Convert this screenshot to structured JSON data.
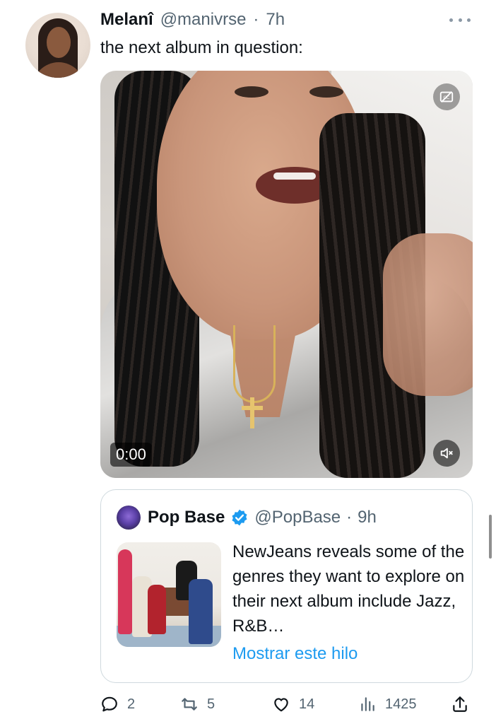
{
  "author": {
    "display_name": "Melanî",
    "handle": "@manivrse",
    "separator": "·",
    "time": "7h"
  },
  "tweet": {
    "text": "the next album in question:"
  },
  "video": {
    "timestamp": "0:00",
    "captions_icon": "closed-captions-icon",
    "mute_icon": "muted-speaker-icon"
  },
  "quote": {
    "display_name": "Pop Base",
    "verified": true,
    "handle": "@PopBase",
    "separator": "·",
    "time": "9h",
    "text": "NewJeans reveals some of the genres they want to explore on their next album include Jazz, R&B…",
    "show_thread": "Mostrar este hilo"
  },
  "actions": {
    "replies": "2",
    "retweets": "5",
    "likes": "14",
    "views": "1425"
  },
  "colors": {
    "accent": "#1d9bf0",
    "secondary_text": "#536471",
    "border": "#cfd9de"
  }
}
